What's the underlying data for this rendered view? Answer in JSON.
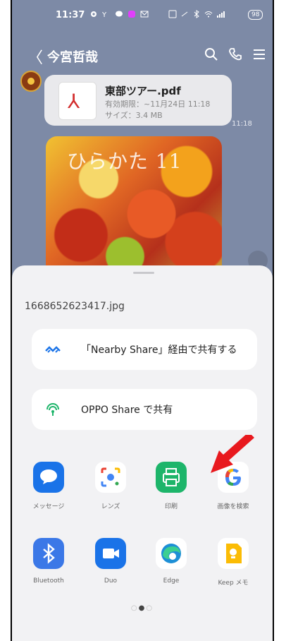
{
  "status_bar": {
    "time": "11:37",
    "battery": "98"
  },
  "header": {
    "back_glyph": "〈",
    "title": "今宮哲哉"
  },
  "message": {
    "file_name": "東部ツアー.pdf",
    "expiry": "有効期限：~11月24日 11:18",
    "size": "サイズ：3.4 MB",
    "time": "11:18"
  },
  "photo": {
    "overlay_text": "ひらかた 11"
  },
  "share_sheet": {
    "filename": "1668652623417.jpg",
    "nearby_label": "「Nearby Share」経由で共有する",
    "oppo_label": "OPPO Share で共有",
    "apps": [
      {
        "name": "メッセージ",
        "icon": "messages-icon",
        "color": "#1a73e8"
      },
      {
        "name": "レンズ",
        "icon": "lens-icon",
        "color": "#ffffff"
      },
      {
        "name": "印刷",
        "icon": "print-icon",
        "color": "#1db56a"
      },
      {
        "name": "画像を検索",
        "icon": "google-icon",
        "color": "#ffffff"
      },
      {
        "name": "Bluetooth",
        "icon": "bluetooth-icon",
        "color": "#3b78e7"
      },
      {
        "name": "Duo",
        "icon": "duo-icon",
        "color": "#1a73e8"
      },
      {
        "name": "Edge",
        "icon": "edge-icon",
        "color": "#ffffff"
      },
      {
        "name": "Keep メモ",
        "icon": "keep-icon",
        "color": "#ffffff"
      }
    ],
    "pager": {
      "pages": 3,
      "current": 2
    }
  },
  "colors": {
    "chat_bg": "#7d8aa6",
    "sheet_bg": "#f2f2f4",
    "arrow": "#e8191e"
  }
}
